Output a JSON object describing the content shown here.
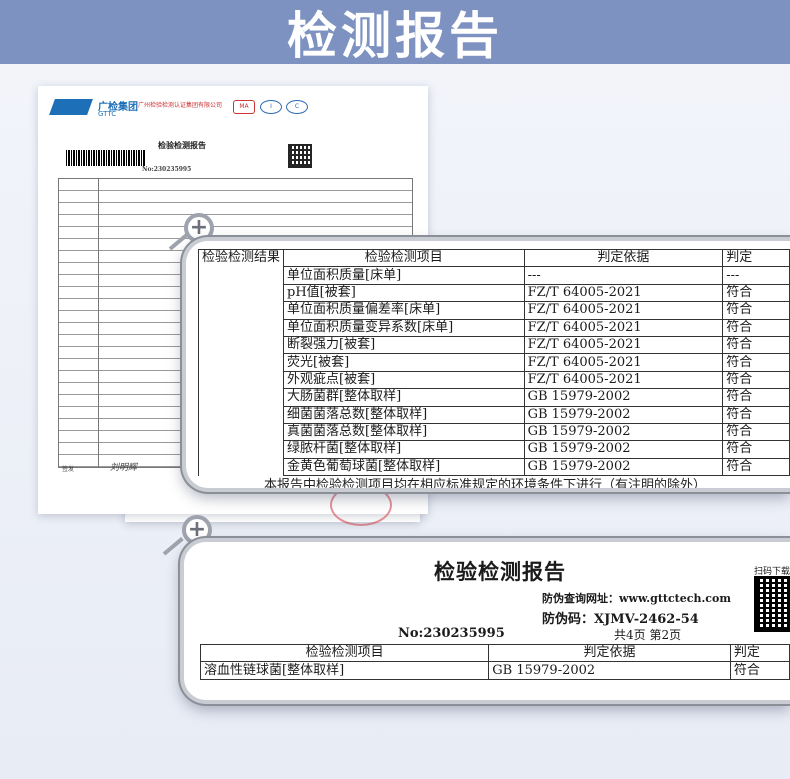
{
  "banner": {
    "title": "检测报告"
  },
  "back_doc": {
    "company": "广检集团",
    "company_en": "GTTC",
    "institute": "广州检验检测认证集团有限公司",
    "report_title": "检验检测报告",
    "report_no": "No:230235995",
    "sig_label": "签发",
    "signature": "刘明辉"
  },
  "zoom1": {
    "header": {
      "col0": "检验检测结果",
      "col1": "检验检测项目",
      "col2": "判定依据",
      "col3": "判定"
    },
    "rows": [
      {
        "item": "单位面积质量[床单]",
        "basis": "---",
        "verdict": "---"
      },
      {
        "item": "pH值[被套]",
        "basis": "FZ/T 64005-2021",
        "verdict": "符合"
      },
      {
        "item": "单位面积质量偏差率[床单]",
        "basis": "FZ/T 64005-2021",
        "verdict": "符合"
      },
      {
        "item": "单位面积质量变异系数[床单]",
        "basis": "FZ/T 64005-2021",
        "verdict": "符合"
      },
      {
        "item": "断裂强力[被套]",
        "basis": "FZ/T 64005-2021",
        "verdict": "符合"
      },
      {
        "item": "荧光[被套]",
        "basis": "FZ/T 64005-2021",
        "verdict": "符合"
      },
      {
        "item": "外观疵点[被套]",
        "basis": "FZ/T 64005-2021",
        "verdict": "符合"
      },
      {
        "item": "大肠菌群[整体取样]",
        "basis": "GB 15979-2002",
        "verdict": "符合"
      },
      {
        "item": "细菌菌落总数[整体取样]",
        "basis": "GB 15979-2002",
        "verdict": "符合"
      },
      {
        "item": "真菌菌落总数[整体取样]",
        "basis": "GB 15979-2002",
        "verdict": "符合"
      },
      {
        "item": "绿脓杆菌[整体取样]",
        "basis": "GB 15979-2002",
        "verdict": "符合"
      },
      {
        "item": "金黄色葡萄球菌[整体取样]",
        "basis": "GB 15979-2002",
        "verdict": "符合"
      }
    ],
    "footnote": "本报告中检验检测项目均在相应标准规定的环境条件下进行（有注明的除外）"
  },
  "zoom2": {
    "title": "检验检测报告",
    "url_line": "防伪查询网址：www.gttctech.com",
    "code_line": "防伪码：XJMV-2462-54",
    "report_no": "No:230235995",
    "page_info": "共4页 第2页",
    "scan_label": "扫码下载",
    "header": {
      "col1": "检验检测项目",
      "col2": "判定依据",
      "col3": "判定"
    },
    "rows": [
      {
        "item": "溶血性链球菌[整体取样]",
        "basis": "GB 15979-2002",
        "verdict": "符合"
      }
    ]
  }
}
